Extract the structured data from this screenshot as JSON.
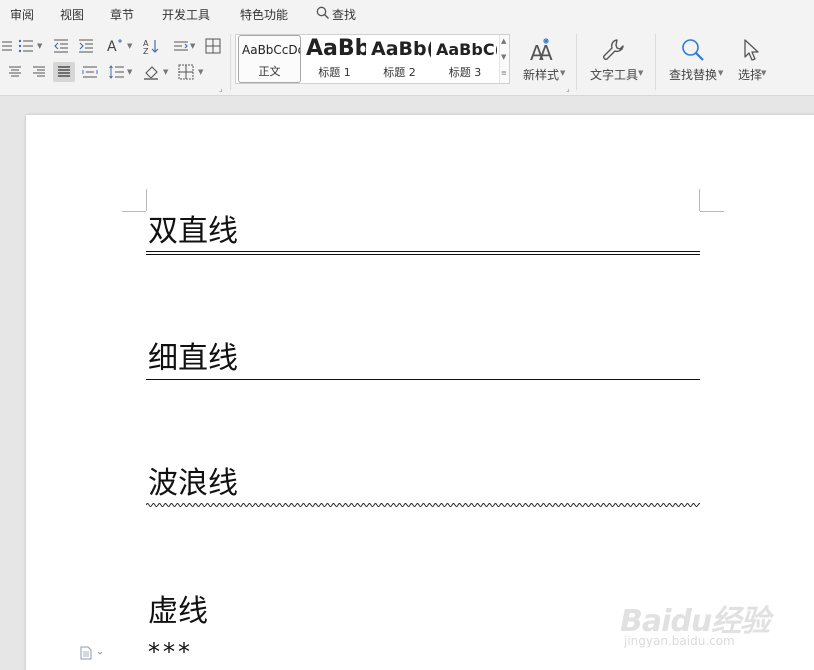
{
  "menu": {
    "items": [
      "审阅",
      "视图",
      "章节",
      "开发工具",
      "特色功能"
    ],
    "search_label": "查找"
  },
  "ribbon": {
    "styles": [
      {
        "sample": "AaBbCcDd",
        "name": "正文",
        "selected": true
      },
      {
        "sample": "AaBb",
        "name": "标题 1"
      },
      {
        "sample": "AaBb(",
        "name": "标题 2"
      },
      {
        "sample": "AaBbC(",
        "name": "标题 3"
      }
    ],
    "new_style_label": "新样式",
    "text_tools_label": "文字工具",
    "find_replace_label": "查找替换",
    "select_label": "选择"
  },
  "document": {
    "headings": [
      {
        "text": "双直线",
        "underline": "double"
      },
      {
        "text": "细直线",
        "underline": "thin"
      },
      {
        "text": "波浪线",
        "underline": "wavy"
      },
      {
        "text": "虚线",
        "underline": "none"
      }
    ],
    "trailing_text": "***"
  },
  "watermark": {
    "logo_text": "Baidu经验",
    "url": "jingyan.baidu.com"
  },
  "colors": {
    "ribbon_bg": "#f3f3f3",
    "workspace_bg": "#e6e6e6",
    "accent_blue": "#2e7bd6"
  }
}
